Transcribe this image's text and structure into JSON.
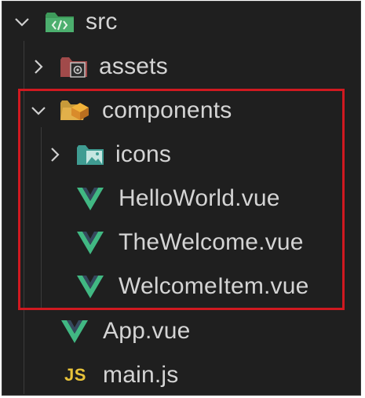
{
  "explorer": {
    "items": [
      {
        "label": "src",
        "type": "folder",
        "expanded": true,
        "icon": "src-folder-icon"
      },
      {
        "label": "assets",
        "type": "folder",
        "expanded": false,
        "icon": "assets-folder-icon"
      },
      {
        "label": "components",
        "type": "folder",
        "expanded": true,
        "icon": "components-folder-icon"
      },
      {
        "label": "icons",
        "type": "folder",
        "expanded": false,
        "icon": "images-folder-icon"
      },
      {
        "label": "HelloWorld.vue",
        "type": "file",
        "icon": "vue-icon"
      },
      {
        "label": "TheWelcome.vue",
        "type": "file",
        "icon": "vue-icon"
      },
      {
        "label": "WelcomeItem.vue",
        "type": "file",
        "icon": "vue-icon"
      },
      {
        "label": "App.vue",
        "type": "file",
        "icon": "vue-icon"
      },
      {
        "label": "main.js",
        "type": "file",
        "icon": "js-icon",
        "badge": "JS"
      }
    ]
  },
  "colors": {
    "background": "#1f1f1f",
    "text": "#d4d4d4",
    "highlight_border": "#d01920",
    "vue_green": "#41b883",
    "vue_dark": "#35495e",
    "js_yellow": "#e8c33a"
  }
}
